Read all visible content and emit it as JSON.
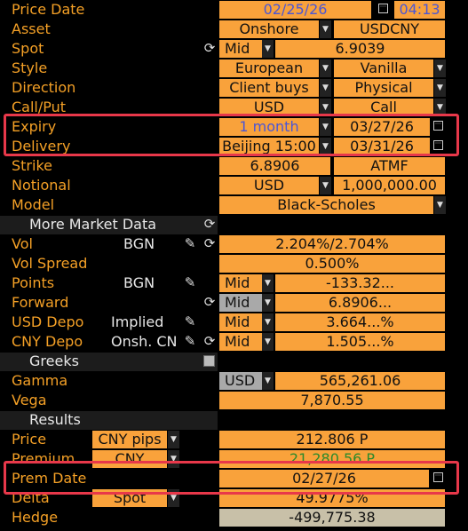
{
  "price_date": {
    "label": "Price Date",
    "date": "02/25/26",
    "time": "04:13"
  },
  "asset": {
    "label": "Asset",
    "market": "Onshore",
    "pair": "USDCNY"
  },
  "spot": {
    "label": "Spot",
    "side": "Mid",
    "value": "6.9039"
  },
  "style": {
    "label": "Style",
    "exercise": "European",
    "type": "Vanilla"
  },
  "direction": {
    "label": "Direction",
    "client": "Client buys",
    "settle": "Physical"
  },
  "callput": {
    "label": "Call/Put",
    "ccy": "USD",
    "type": "Call"
  },
  "expiry": {
    "label": "Expiry",
    "tenor": "1 month",
    "date": "03/27/26"
  },
  "delivery": {
    "label": "Delivery",
    "cut": "Beijing 15:00",
    "date": "03/31/26"
  },
  "strike": {
    "label": "Strike",
    "value": "6.8906",
    "ref": "ATMF"
  },
  "notional": {
    "label": "Notional",
    "ccy": "USD",
    "value": "1,000,000.00"
  },
  "model": {
    "label": "Model",
    "value": "Black-Scholes"
  },
  "market_data": {
    "title": "More Market Data"
  },
  "vol": {
    "label": "Vol",
    "source": "BGN",
    "value": "2.204%/2.704%"
  },
  "vol_spread": {
    "label": "Vol Spread",
    "value": "0.500%"
  },
  "points": {
    "label": "Points",
    "source": "BGN",
    "side": "Mid",
    "value": "-133.32..."
  },
  "forward": {
    "label": "Forward",
    "side": "Mid",
    "value": "6.8906..."
  },
  "usd_depo": {
    "label": "USD Depo",
    "source": "Implied",
    "side": "Mid",
    "value": "3.664...%"
  },
  "cny_depo": {
    "label": "CNY Depo",
    "source": "Onsh. CN",
    "side": "Mid",
    "value": "1.505...%"
  },
  "greeks": {
    "title": "Greeks"
  },
  "gamma": {
    "label": "Gamma",
    "ccy": "USD",
    "value": "565,261.06"
  },
  "vega": {
    "label": "Vega",
    "value": "7,870.55"
  },
  "results": {
    "title": "Results"
  },
  "price": {
    "label": "Price",
    "unit": "CNY pips",
    "value": "212.806 P"
  },
  "premium": {
    "label": "Premium",
    "ccy": "CNY",
    "value": "21,280.56 P"
  },
  "prem_date": {
    "label": "Prem Date",
    "date": "02/27/26"
  },
  "delta": {
    "label": "Delta",
    "type": "Spot",
    "value": "49.9775%"
  },
  "hedge": {
    "label": "Hedge",
    "value": "-499,775.38"
  },
  "colors": {
    "accent": "#f9a23b",
    "label": "#f4a026",
    "highlight": "#e8384a",
    "blue_text": "#4a56d6",
    "green_text": "#2c8a2c"
  }
}
